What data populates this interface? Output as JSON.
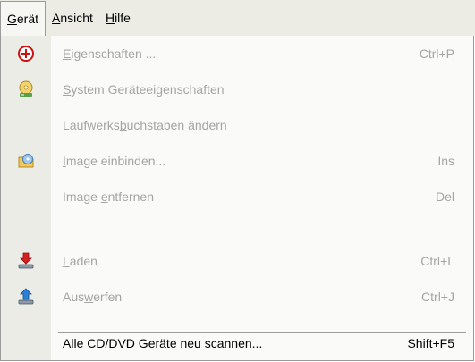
{
  "menubar": {
    "items": [
      {
        "pre": "",
        "key": "G",
        "post": "erät"
      },
      {
        "pre": "",
        "key": "A",
        "post": "nsicht"
      },
      {
        "pre": "",
        "key": "H",
        "post": "ilfe"
      }
    ]
  },
  "menu": {
    "items": [
      {
        "pre": "",
        "key": "E",
        "post": "igenschaften ...",
        "shortcut": "Ctrl+P",
        "enabled": false,
        "icon": "properties-plus-icon"
      },
      {
        "pre": "",
        "key": "S",
        "post": "ystem Geräteeigenschaften",
        "shortcut": "",
        "enabled": false,
        "icon": "device-properties-icon"
      },
      {
        "pre": "Laufwerks",
        "key": "b",
        "post": "uchstaben ändern",
        "shortcut": "",
        "enabled": false,
        "icon": ""
      },
      {
        "pre": "",
        "key": "I",
        "post": "mage einbinden...",
        "shortcut": "Ins",
        "enabled": false,
        "icon": "mount-image-icon"
      },
      {
        "pre": "Image ",
        "key": "e",
        "post": "ntfernen",
        "shortcut": "Del",
        "enabled": false,
        "icon": ""
      },
      {
        "pre": "",
        "key": "L",
        "post": "aden",
        "shortcut": "Ctrl+L",
        "enabled": false,
        "icon": "load-disc-icon"
      },
      {
        "pre": "Aus",
        "key": "w",
        "post": "erfen",
        "shortcut": "Ctrl+J",
        "enabled": false,
        "icon": "eject-disc-icon"
      },
      {
        "pre": "",
        "key": "A",
        "post": "lle CD/DVD Geräte neu scannen...",
        "shortcut": "Shift+F5",
        "enabled": true,
        "icon": ""
      }
    ]
  }
}
